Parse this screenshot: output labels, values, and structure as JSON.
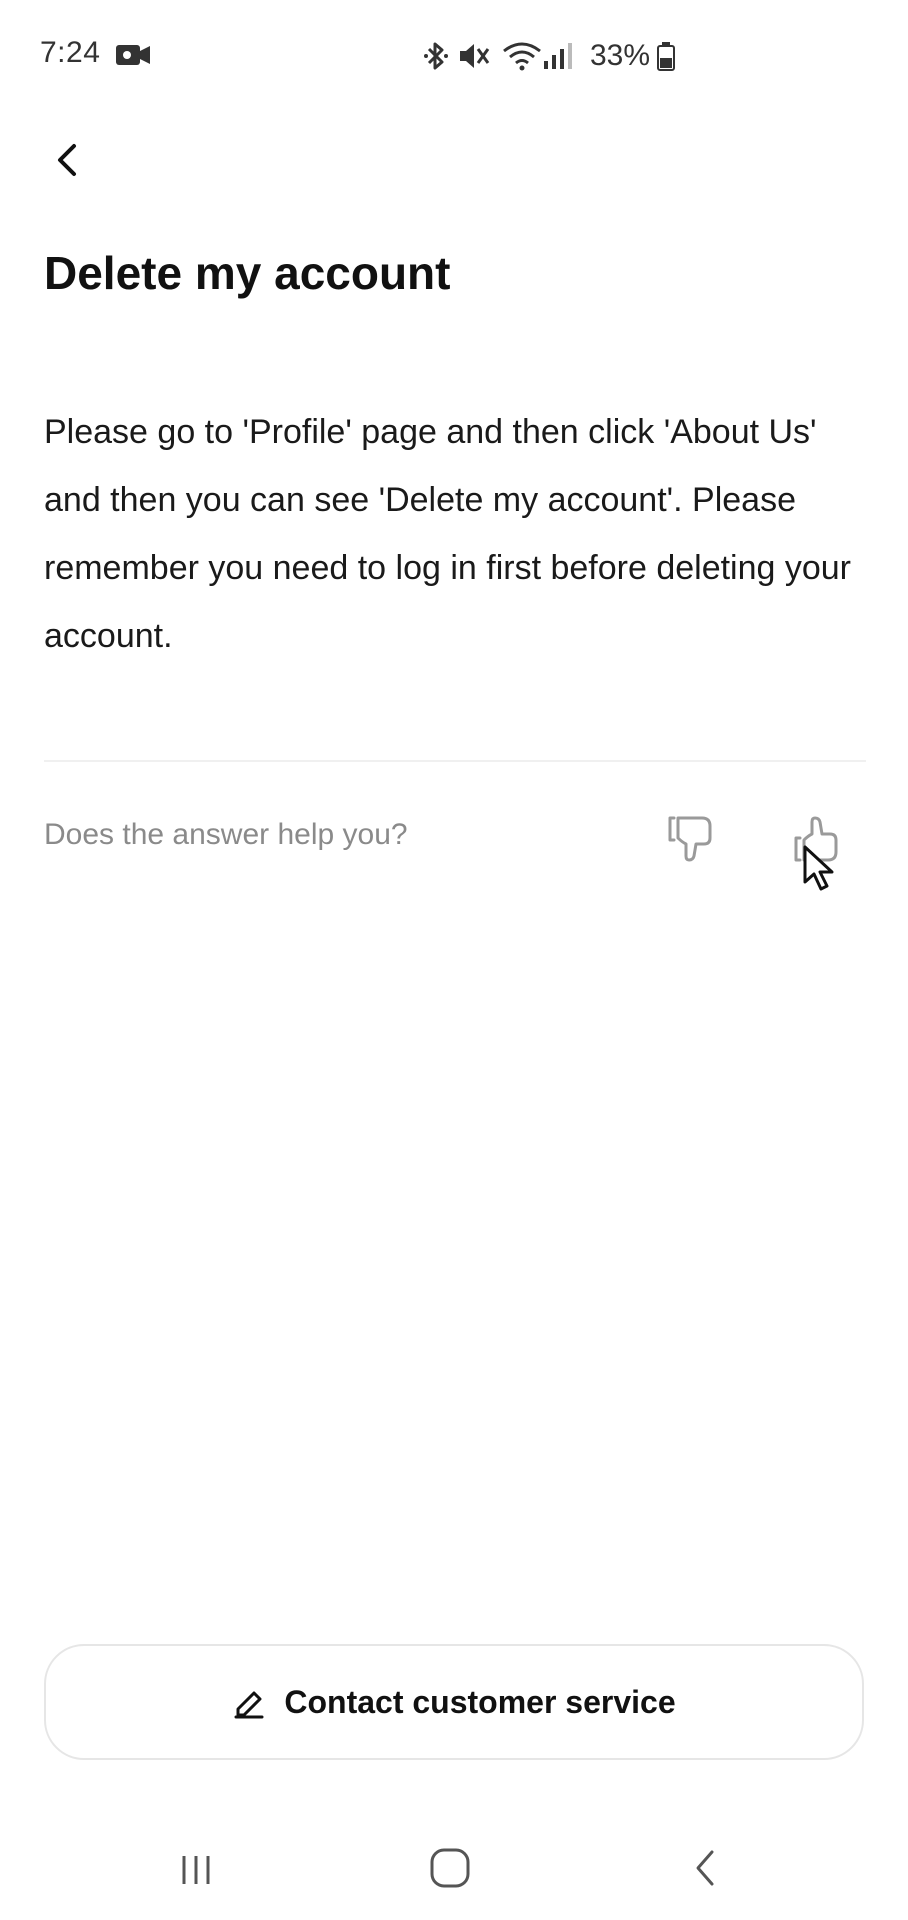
{
  "status_bar": {
    "time": "7:24",
    "battery": "33%",
    "icons": [
      "video-camera-icon",
      "bluetooth-icon",
      "mute-icon",
      "wifi-icon",
      "signal-icon",
      "battery-icon"
    ]
  },
  "header": {
    "back_icon": "chevron-left-icon"
  },
  "article": {
    "title": "Delete my account",
    "body": "Please go to 'Profile' page and then click 'About Us' and then you can see 'Delete my account'. Please remember you need to log in first before deleting your account."
  },
  "feedback": {
    "question": "Does the answer help you?",
    "icons": [
      "thumbs-down-icon",
      "thumbs-up-icon"
    ]
  },
  "contact": {
    "label": "Contact customer service",
    "icon": "edit-icon"
  },
  "nav_bar": {
    "icons": [
      "recents-icon",
      "home-icon",
      "back-icon"
    ]
  },
  "colors": {
    "text_primary": "#111111",
    "text_secondary": "#8a8a8a",
    "divider": "#f0f0f0",
    "button_border": "#e6e6e6"
  }
}
